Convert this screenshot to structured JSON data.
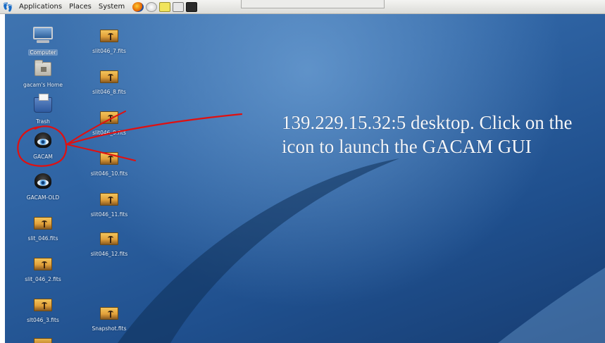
{
  "panel": {
    "menus": [
      "Applications",
      "Places",
      "System"
    ],
    "launchers": [
      "firefox-icon",
      "mail-icon",
      "text-editor-icon",
      "calculator-icon",
      "terminal-icon"
    ]
  },
  "desktop": {
    "icons_left": [
      {
        "name": "Computer",
        "type": "computer",
        "selected": true
      },
      {
        "name": "gacam's Home",
        "type": "home"
      },
      {
        "name": "Trash",
        "type": "trash"
      },
      {
        "name": "GACAM",
        "type": "app"
      },
      {
        "name": "GACAM-OLD",
        "type": "app"
      },
      {
        "name": "slit_046.fits",
        "type": "fits"
      },
      {
        "name": "slit_046_2.fits",
        "type": "fits"
      },
      {
        "name": "slt046_3.fits",
        "type": "fits"
      }
    ],
    "icons_right": [
      {
        "name": "slit046_7.fits",
        "type": "fits"
      },
      {
        "name": "slit046_8.fits",
        "type": "fits"
      },
      {
        "name": "slit046_9.fits",
        "type": "fits"
      },
      {
        "name": "slit046_10.fits",
        "type": "fits"
      },
      {
        "name": "slit046_11.fits",
        "type": "fits"
      },
      {
        "name": "slit046_12.fits",
        "type": "fits"
      },
      {
        "name": "Snapshot.fits",
        "type": "fits"
      }
    ]
  },
  "annotation": {
    "text": "139.229.15.32:5 desktop. Click on the icon to launch the GACAM GUI",
    "color": "#e01010"
  }
}
